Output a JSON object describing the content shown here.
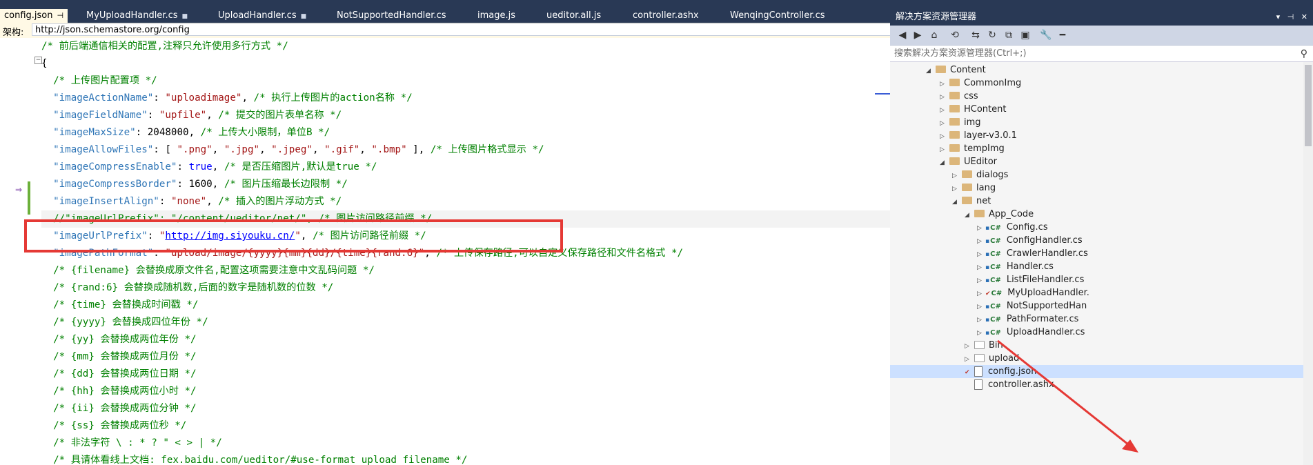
{
  "tabs": [
    {
      "label": "config.json",
      "active": true
    },
    {
      "label": "MyUploadHandler.cs"
    },
    {
      "label": "UploadHandler.cs"
    },
    {
      "label": "NotSupportedHandler.cs"
    },
    {
      "label": "image.js"
    },
    {
      "label": "ueditor.all.js"
    },
    {
      "label": "controller.ashx"
    },
    {
      "label": "WenqingController.cs"
    }
  ],
  "schema": {
    "label": "架构:",
    "url": "http://json.schemastore.org/config"
  },
  "code_lines": [
    [
      [
        "c-cm",
        "/* 前后端通信相关的配置,注释只允许使用多行方式 */"
      ]
    ],
    [
      [
        "c-pun",
        "{"
      ]
    ],
    [
      [
        "c-cm",
        "  /* 上传图片配置项 */"
      ]
    ],
    [
      [
        "c-key",
        "  \"imageActionName\""
      ],
      [
        "c-pun",
        ": "
      ],
      [
        "c-str",
        "\"uploadimage\""
      ],
      [
        "c-pun",
        ", "
      ],
      [
        "c-cm",
        "/* 执行上传图片的action名称 */"
      ]
    ],
    [
      [
        "c-key",
        "  \"imageFieldName\""
      ],
      [
        "c-pun",
        ": "
      ],
      [
        "c-str",
        "\"upfile\""
      ],
      [
        "c-pun",
        ", "
      ],
      [
        "c-cm",
        "/* 提交的图片表单名称 */"
      ]
    ],
    [
      [
        "c-key",
        "  \"imageMaxSize\""
      ],
      [
        "c-pun",
        ": "
      ],
      [
        "c-num",
        "2048000"
      ],
      [
        "c-pun",
        ", "
      ],
      [
        "c-cm",
        "/* 上传大小限制，单位B */"
      ]
    ],
    [
      [
        "c-key",
        "  \"imageAllowFiles\""
      ],
      [
        "c-pun",
        ": [ "
      ],
      [
        "c-str",
        "\".png\""
      ],
      [
        "c-pun",
        ", "
      ],
      [
        "c-str",
        "\".jpg\""
      ],
      [
        "c-pun",
        ", "
      ],
      [
        "c-str",
        "\".jpeg\""
      ],
      [
        "c-pun",
        ", "
      ],
      [
        "c-str",
        "\".gif\""
      ],
      [
        "c-pun",
        ", "
      ],
      [
        "c-str",
        "\".bmp\""
      ],
      [
        "c-pun",
        " ], "
      ],
      [
        "c-cm",
        "/* 上传图片格式显示 */"
      ]
    ],
    [
      [
        "c-key",
        "  \"imageCompressEnable\""
      ],
      [
        "c-pun",
        ": "
      ],
      [
        "c-kw",
        "true"
      ],
      [
        "c-pun",
        ", "
      ],
      [
        "c-cm",
        "/* 是否压缩图片,默认是true */"
      ]
    ],
    [
      [
        "c-key",
        "  \"imageCompressBorder\""
      ],
      [
        "c-pun",
        ": "
      ],
      [
        "c-num",
        "1600"
      ],
      [
        "c-pun",
        ", "
      ],
      [
        "c-cm",
        "/* 图片压缩最长边限制 */"
      ]
    ],
    [
      [
        "c-key",
        "  \"imageInsertAlign\""
      ],
      [
        "c-pun",
        ": "
      ],
      [
        "c-str",
        "\"none\""
      ],
      [
        "c-pun",
        ", "
      ],
      [
        "c-cm",
        "/* 插入的图片浮动方式 */"
      ]
    ],
    [
      [
        "c-cm",
        "  //\"imageUrlPrefix\": \"/content/ueditor/net/\", /* 图片访问路径前缀 */"
      ]
    ],
    [
      [
        "c-key",
        "  \"imageUrlPrefix\""
      ],
      [
        "c-pun",
        ": "
      ],
      [
        "c-str",
        "\""
      ],
      [
        "c-url",
        "http://img.siyouku.cn/"
      ],
      [
        "c-str",
        "\""
      ],
      [
        "c-pun",
        ", "
      ],
      [
        "c-cm",
        "/* 图片访问路径前缀 */"
      ]
    ],
    [
      [
        "c-key",
        "  \"imagePathFormat\""
      ],
      [
        "c-pun",
        ": "
      ],
      [
        "c-str",
        "\"upload/image/{yyyy}{mm}{dd}/{time}{rand:6}\""
      ],
      [
        "c-pun",
        ", "
      ],
      [
        "c-cm",
        "/* 上传保存路径,可以自定义保存路径和文件名格式 */"
      ]
    ],
    [
      [
        "c-cm",
        "  /* {filename} 会替换成原文件名,配置这项需要注意中文乱码问题 */"
      ]
    ],
    [
      [
        "c-cm",
        "  /* {rand:6} 会替换成随机数,后面的数字是随机数的位数 */"
      ]
    ],
    [
      [
        "c-cm",
        "  /* {time} 会替换成时间戳 */"
      ]
    ],
    [
      [
        "c-cm",
        "  /* {yyyy} 会替换成四位年份 */"
      ]
    ],
    [
      [
        "c-cm",
        "  /* {yy} 会替换成两位年份 */"
      ]
    ],
    [
      [
        "c-cm",
        "  /* {mm} 会替换成两位月份 */"
      ]
    ],
    [
      [
        "c-cm",
        "  /* {dd} 会替换成两位日期 */"
      ]
    ],
    [
      [
        "c-cm",
        "  /* {hh} 会替换成两位小时 */"
      ]
    ],
    [
      [
        "c-cm",
        "  /* {ii} 会替换成两位分钟 */"
      ]
    ],
    [
      [
        "c-cm",
        "  /* {ss} 会替换成两位秒 */"
      ]
    ],
    [
      [
        "c-cm",
        "  /* 非法字符 \\ : * ? \" < > | */"
      ]
    ],
    [
      [
        "c-cm",
        "  /* 具请体看线上文档: fex.baidu.com/ueditor/#use-format_upload_filename */"
      ]
    ]
  ],
  "panel": {
    "title": "解决方案资源管理器",
    "search_placeholder": "搜索解决方案资源管理器(Ctrl+;)"
  },
  "tree": [
    {
      "label": "Content",
      "kind": "folder",
      "expanded": true
    },
    {
      "label": "CommonImg",
      "kind": "folder"
    },
    {
      "label": "css",
      "kind": "folder"
    },
    {
      "label": "HContent",
      "kind": "folder"
    },
    {
      "label": "img",
      "kind": "folder"
    },
    {
      "label": "layer-v3.0.1",
      "kind": "folder"
    },
    {
      "label": "tempImg",
      "kind": "folder"
    },
    {
      "label": "UEditor",
      "kind": "folder",
      "expanded": true
    },
    {
      "label": "dialogs",
      "kind": "folder"
    },
    {
      "label": "lang",
      "kind": "folder"
    },
    {
      "label": "net",
      "kind": "folder",
      "expanded": true
    },
    {
      "label": "App_Code",
      "kind": "folder",
      "expanded": true
    },
    {
      "label": "Config.cs",
      "kind": "cs"
    },
    {
      "label": "ConfigHandler.cs",
      "kind": "cs"
    },
    {
      "label": "CrawlerHandler.cs",
      "kind": "cs"
    },
    {
      "label": "Handler.cs",
      "kind": "cs"
    },
    {
      "label": "ListFileHandler.cs",
      "kind": "cs"
    },
    {
      "label": "MyUploadHandler.",
      "kind": "cs",
      "checked": true
    },
    {
      "label": "NotSupportedHan",
      "kind": "cs"
    },
    {
      "label": "PathFormater.cs",
      "kind": "cs"
    },
    {
      "label": "UploadHandler.cs",
      "kind": "cs"
    },
    {
      "label": "Bin",
      "kind": "empty"
    },
    {
      "label": "upload",
      "kind": "empty"
    },
    {
      "label": "config.json",
      "kind": "file",
      "selected": true,
      "checked": true
    },
    {
      "label": "controller.ashx",
      "kind": "file"
    }
  ],
  "colors": {
    "accent": "#293955",
    "highlight_box": "#e53935",
    "annotation_arrow": "#e53935"
  },
  "icons": [
    "pin-icon",
    "lock-icon",
    "back-icon",
    "forward-icon",
    "home-icon",
    "history-icon",
    "sync-icon",
    "refresh-icon",
    "collapse-icon",
    "show-all-icon",
    "wrench-icon",
    "search-icon"
  ]
}
